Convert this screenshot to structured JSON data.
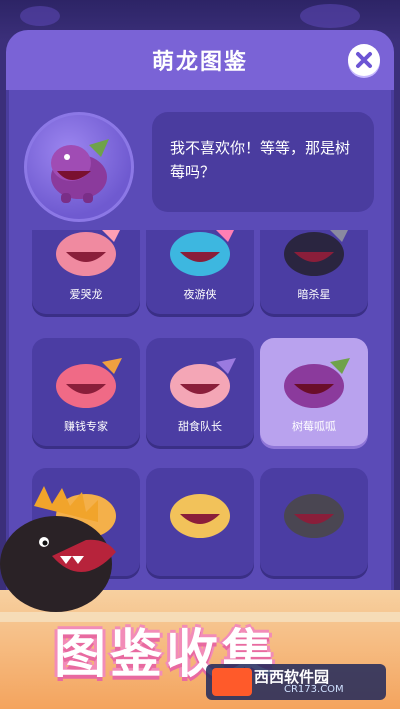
{
  "modal": {
    "title": "萌龙图鉴",
    "close_icon": "close-icon",
    "featured": {
      "name": "树莓呱呱",
      "speech": "我不喜欢你！等等，那是树莓吗？"
    }
  },
  "cards": [
    {
      "label": "爱哭龙",
      "color": "#f08aa0",
      "selected": false
    },
    {
      "label": "夜游侠",
      "color": "#3db7e0",
      "selected": false
    },
    {
      "label": "暗杀星",
      "color": "#2a2540",
      "selected": false
    },
    {
      "label": "赚钱专家",
      "color": "#f06a86",
      "selected": false
    },
    {
      "label": "甜食队长",
      "color": "#f4a6b6",
      "selected": false
    },
    {
      "label": "树莓呱呱",
      "color": "#8b3a9c",
      "selected": true
    },
    {
      "label": "",
      "color": "#f4b04a",
      "selected": false
    },
    {
      "label": "",
      "color": "#f2c25a",
      "selected": false
    },
    {
      "label": "",
      "color": "#4a4652",
      "selected": false
    }
  ],
  "banner": {
    "title": "图鉴收集"
  },
  "watermark": {
    "brand": "西西软件园",
    "url": "CR173.COM"
  },
  "colors": {
    "modal_bg": "#5b4bb7",
    "header_bg": "#7a63d6",
    "card_bg": "#4b3da3",
    "card_selected_bg": "#b9a2ee",
    "banner": "#f4a45e"
  }
}
